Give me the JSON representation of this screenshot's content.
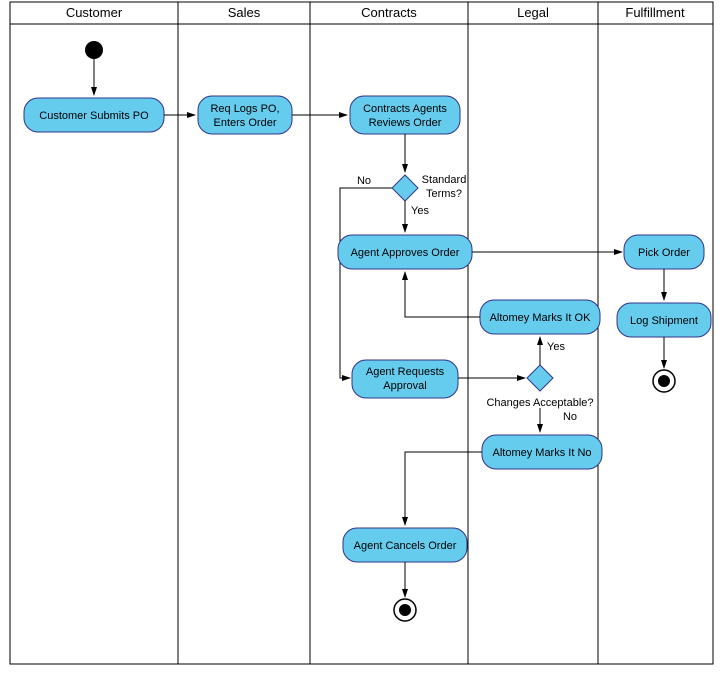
{
  "lanes": {
    "customer": "Customer",
    "sales": "Sales",
    "contracts": "Contracts",
    "legal": "Legal",
    "fulfillment": "Fulfillment"
  },
  "activities": {
    "submit": "Customer Submits PO",
    "reqlogs_l1": "Req Logs PO,",
    "reqlogs_l2": "Enters Order",
    "review_l1": "Contracts Agents",
    "review_l2": "Reviews Order",
    "approve": "Agent Approves Order",
    "reqapprove_l1": "Agent Requests",
    "reqapprove_l2": "Approval",
    "attok": "Altomey Marks It OK",
    "attno": "Altomey Marks It No",
    "cancel": "Agent Cancels Order",
    "pick": "Pick Order",
    "logship": "Log Shipment"
  },
  "decisions": {
    "stdterms_l1": "Standard",
    "stdterms_l2": "Terms?",
    "changes": "Changes Acceptable?"
  },
  "labels": {
    "yes": "Yes",
    "no": "No"
  },
  "chart_data": {
    "type": "activity_diagram",
    "swimlanes": [
      "Customer",
      "Sales",
      "Contracts",
      "Legal",
      "Fulfillment"
    ],
    "initial": {
      "lane": "Customer"
    },
    "activities": [
      {
        "id": "submit",
        "label": "Customer Submits PO",
        "lane": "Customer"
      },
      {
        "id": "reqlogs",
        "label": "Req Logs PO, Enters Order",
        "lane": "Sales"
      },
      {
        "id": "review",
        "label": "Contracts Agents Reviews Order",
        "lane": "Contracts"
      },
      {
        "id": "stdterms",
        "label": "Standard Terms?",
        "lane": "Contracts",
        "type": "decision"
      },
      {
        "id": "approve",
        "label": "Agent Approves Order",
        "lane": "Contracts"
      },
      {
        "id": "reqapprove",
        "label": "Agent Requests Approval",
        "lane": "Contracts"
      },
      {
        "id": "changes",
        "label": "Changes Acceptable?",
        "lane": "Legal",
        "type": "decision"
      },
      {
        "id": "attok",
        "label": "Altomey Marks It OK",
        "lane": "Legal"
      },
      {
        "id": "attno",
        "label": "Altomey Marks It No",
        "lane": "Legal"
      },
      {
        "id": "cancel",
        "label": "Agent Cancels Order",
        "lane": "Contracts"
      },
      {
        "id": "pick",
        "label": "Pick Order",
        "lane": "Fulfillment"
      },
      {
        "id": "logship",
        "label": "Log Shipment",
        "lane": "Fulfillment"
      }
    ],
    "edges": [
      {
        "from": "initial",
        "to": "submit"
      },
      {
        "from": "submit",
        "to": "reqlogs"
      },
      {
        "from": "reqlogs",
        "to": "review"
      },
      {
        "from": "review",
        "to": "stdterms"
      },
      {
        "from": "stdterms",
        "to": "approve",
        "label": "Yes"
      },
      {
        "from": "stdterms",
        "to": "reqapprove",
        "label": "No"
      },
      {
        "from": "approve",
        "to": "pick"
      },
      {
        "from": "reqapprove",
        "to": "changes"
      },
      {
        "from": "changes",
        "to": "attok",
        "label": "Yes"
      },
      {
        "from": "changes",
        "to": "attno",
        "label": "No"
      },
      {
        "from": "attok",
        "to": "approve"
      },
      {
        "from": "attno",
        "to": "cancel"
      },
      {
        "from": "cancel",
        "to": "final1"
      },
      {
        "from": "pick",
        "to": "logship"
      },
      {
        "from": "logship",
        "to": "final2"
      }
    ],
    "finals": [
      {
        "id": "final1",
        "lane": "Contracts"
      },
      {
        "id": "final2",
        "lane": "Fulfillment"
      }
    ]
  }
}
